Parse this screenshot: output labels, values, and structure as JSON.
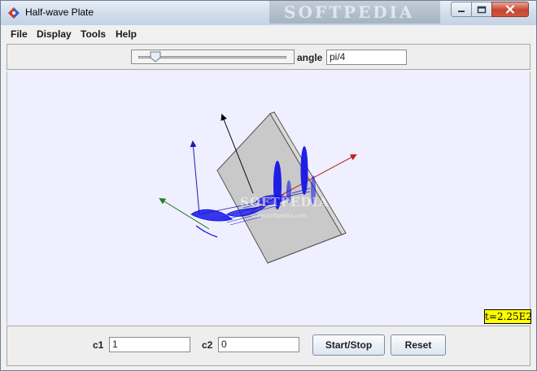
{
  "window": {
    "title": "Half-wave Plate",
    "title_watermark": "SOFTPEDIA"
  },
  "menu": {
    "items": [
      {
        "label": "File"
      },
      {
        "label": "Display"
      },
      {
        "label": "Tools"
      },
      {
        "label": "Help"
      }
    ]
  },
  "controls": {
    "slider_value_fraction": 0.08,
    "angle_label": "angle",
    "angle_value": "pi/4"
  },
  "canvas": {
    "time_readout": "t=2.25E2",
    "center_watermark": "SOFTPEDIA",
    "center_watermark_sub": "www.softpedia.com",
    "colors": {
      "background": "#efefff",
      "wave": "#1515e8",
      "plate_fill": "#c8c8c8",
      "arrow_red": "#c02020",
      "arrow_green": "#208020",
      "arrow_blue": "#1a1ab8",
      "arrow_black": "#000000"
    }
  },
  "bottom": {
    "c1_label": "c1",
    "c1_value": "1",
    "c2_label": "c2",
    "c2_value": "0",
    "start_stop_label": "Start/Stop",
    "reset_label": "Reset"
  }
}
